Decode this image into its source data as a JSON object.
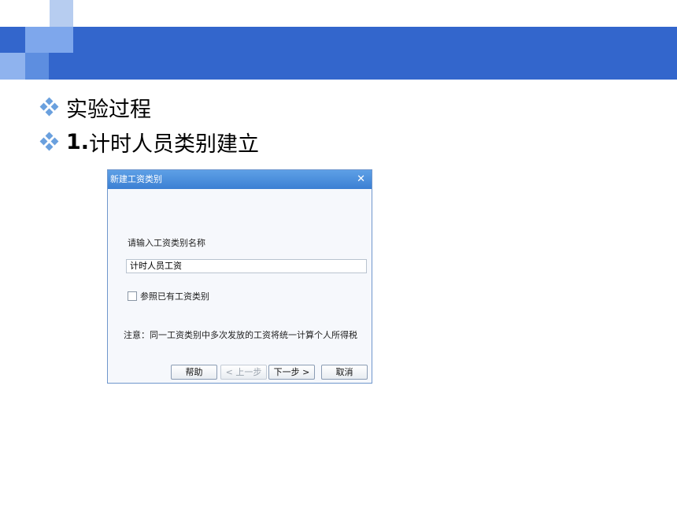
{
  "colors": {
    "header_bar": "#3366cc",
    "dialog_title": "#3b7fd3",
    "bullet": "#6aa0de"
  },
  "bullets": [
    {
      "number": "",
      "text": "实验过程"
    },
    {
      "number": "1.",
      "text": "计时人员类别建立"
    }
  ],
  "dialog": {
    "title": "新建工资类别",
    "close_icon": "close-icon",
    "prompt": "请输入工资类别名称",
    "name_value": "计时人员工资",
    "checkbox_label": "参照已有工资类别",
    "checkbox_checked": false,
    "note": "注意：同一工资类别中多次发放的工资将统一计算个人所得税",
    "buttons": {
      "help": "帮助",
      "prev": "< 上一步",
      "next": "下一步 >",
      "cancel": "取消"
    }
  }
}
